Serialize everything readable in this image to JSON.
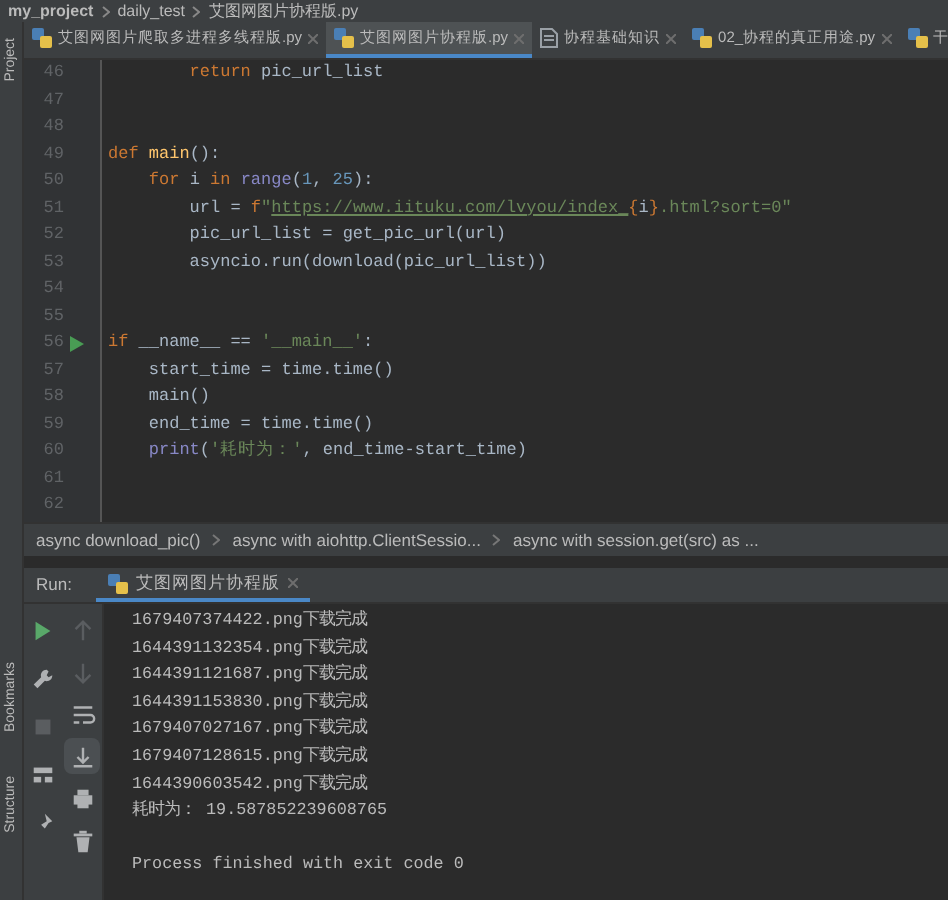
{
  "breadcrumb_top": [
    "my_project",
    "daily_test",
    "艾图网图片协程版.py"
  ],
  "tabs": [
    {
      "label": "艾图网图片爬取多进程多线程版.py",
      "kind": "python",
      "selected": false
    },
    {
      "label": "艾图网图片协程版.py",
      "kind": "python",
      "selected": true
    },
    {
      "label": "协程基础知识",
      "kind": "text",
      "selected": false
    },
    {
      "label": "02_协程的真正用途.py",
      "kind": "python",
      "selected": false
    },
    {
      "label": "干",
      "kind": "python",
      "selected": false
    }
  ],
  "side_labels": [
    "Project",
    "Bookmarks",
    "Structure"
  ],
  "code_lines": [
    {
      "number": "46",
      "run_marker": false,
      "tokens": [
        {
          "kind": "keyword",
          "text": "        return"
        },
        {
          "kind": "plain",
          "text": " pic_url_list"
        }
      ]
    },
    {
      "number": "47",
      "run_marker": false
    },
    {
      "number": "48",
      "run_marker": false
    },
    {
      "number": "49",
      "run_marker": false,
      "tokens": [
        {
          "kind": "keyword",
          "text": "def"
        },
        {
          "kind": "function",
          "text": " main"
        },
        {
          "kind": "plain",
          "text": "():"
        }
      ]
    },
    {
      "number": "50",
      "run_marker": false,
      "tokens": [
        {
          "kind": "keyword",
          "text": "    for"
        },
        {
          "kind": "plain",
          "text": " i "
        },
        {
          "kind": "keyword",
          "text": "in"
        },
        {
          "kind": "builtin",
          "text": " range"
        },
        {
          "kind": "plain",
          "text": "("
        },
        {
          "kind": "number",
          "text": "1"
        },
        {
          "kind": "plain",
          "text": ", "
        },
        {
          "kind": "number",
          "text": "25"
        },
        {
          "kind": "plain",
          "text": "):"
        }
      ]
    },
    {
      "number": "51",
      "run_marker": false,
      "tokens": [
        {
          "kind": "plain",
          "text": "        url = "
        },
        {
          "kind": "keyword",
          "text": "f"
        },
        {
          "kind": "string",
          "text": "\""
        },
        {
          "kind": "link",
          "text": "https://www.iituku.com/lvyou/index_"
        },
        {
          "kind": "keyword",
          "text": "{"
        },
        {
          "kind": "plain",
          "text": "i"
        },
        {
          "kind": "keyword",
          "text": "}"
        },
        {
          "kind": "string",
          "text": ".html?sort=0\""
        }
      ]
    },
    {
      "number": "52",
      "run_marker": false,
      "tokens": [
        {
          "kind": "plain",
          "text": "        pic_url_list = get_pic_url(url)"
        }
      ]
    },
    {
      "number": "53",
      "run_marker": false,
      "tokens": [
        {
          "kind": "plain",
          "text": "        asyncio.run(download(pic_url_list))"
        }
      ]
    },
    {
      "number": "54",
      "run_marker": false
    },
    {
      "number": "55",
      "run_marker": false
    },
    {
      "number": "56",
      "run_marker": true,
      "tokens": [
        {
          "kind": "keyword",
          "text": "if"
        },
        {
          "kind": "plain",
          "text": " __name__ == "
        },
        {
          "kind": "string",
          "text": "'__main__'"
        },
        {
          "kind": "plain",
          "text": ":"
        }
      ]
    },
    {
      "number": "57",
      "run_marker": false,
      "tokens": [
        {
          "kind": "plain",
          "text": "    start_time = time.time()"
        }
      ]
    },
    {
      "number": "58",
      "run_marker": false,
      "tokens": [
        {
          "kind": "plain",
          "text": "    main()"
        }
      ]
    },
    {
      "number": "59",
      "run_marker": false,
      "tokens": [
        {
          "kind": "plain",
          "text": "    end_time = time.time()"
        }
      ]
    },
    {
      "number": "60",
      "run_marker": false,
      "tokens": [
        {
          "kind": "builtin",
          "text": "    print"
        },
        {
          "kind": "plain",
          "text": "("
        },
        {
          "kind": "string",
          "text": "'耗时为：'"
        },
        {
          "kind": "plain",
          "text": ", end_time-start_time)"
        }
      ]
    },
    {
      "number": "61",
      "run_marker": false
    },
    {
      "number": "62",
      "run_marker": false
    }
  ],
  "structure_path": [
    "async download_pic()",
    "async with aiohttp.ClientSessio...",
    "async with session.get(src) as ..."
  ],
  "run_panel": {
    "label": "Run:",
    "tab": "艾图网图片协程版",
    "tools_left": [
      {
        "kind": "run",
        "disabled": false
      },
      {
        "kind": "wrench",
        "disabled": false
      },
      {
        "kind": "stop",
        "disabled": true
      },
      {
        "kind": "layout",
        "disabled": false
      },
      {
        "kind": "pin",
        "disabled": false
      }
    ],
    "tools_right": [
      {
        "kind": "up",
        "disabled": true,
        "selected": false
      },
      {
        "kind": "down",
        "disabled": true,
        "selected": false
      },
      {
        "kind": "wrap",
        "disabled": false,
        "selected": false
      },
      {
        "kind": "scroll-end",
        "disabled": false,
        "selected": true
      },
      {
        "kind": "print",
        "disabled": false,
        "selected": false
      },
      {
        "kind": "trash",
        "disabled": false,
        "selected": false
      }
    ],
    "output": [
      {
        "kind": "line",
        "text": "1679407374422.png下载完成"
      },
      {
        "kind": "line",
        "text": "1644391132354.png下载完成"
      },
      {
        "kind": "line",
        "text": "1644391121687.png下载完成"
      },
      {
        "kind": "line",
        "text": "1644391153830.png下载完成"
      },
      {
        "kind": "line",
        "text": "1679407027167.png下载完成"
      },
      {
        "kind": "line",
        "text": "1679407128615.png下载完成"
      },
      {
        "kind": "line",
        "text": "1644390603542.png下载完成"
      },
      {
        "kind": "line",
        "text": "耗时为： 19.587852239608765"
      },
      {
        "kind": "blank"
      },
      {
        "kind": "line",
        "text": "Process finished with exit code 0"
      }
    ]
  }
}
